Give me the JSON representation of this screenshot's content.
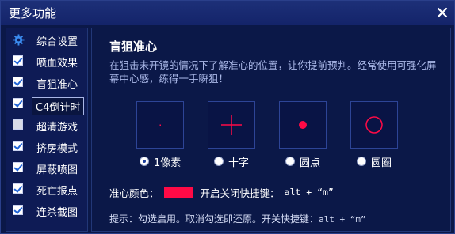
{
  "window": {
    "title": "更多功能"
  },
  "sidebar": {
    "items": [
      {
        "label": "综合设置",
        "icon": "gear-icon",
        "checked": null
      },
      {
        "label": "喷血效果",
        "checked": true
      },
      {
        "label": "盲狙准心",
        "checked": true
      },
      {
        "label": "C4倒计时",
        "checked": true,
        "selected": true
      },
      {
        "label": "超清游戏",
        "checked": false
      },
      {
        "label": "挤房模式",
        "checked": true
      },
      {
        "label": "屏蔽喷图",
        "checked": true
      },
      {
        "label": "死亡报点",
        "checked": true
      },
      {
        "label": "连杀截图",
        "checked": true
      }
    ]
  },
  "main": {
    "title": "盲狙准心",
    "description": "在狙击未开镜的情况下了解准心的位置，让你提前预判。经常使用可强化屏幕中心感，练得一手瞬狙！",
    "crosshair_options": [
      {
        "label": "1像素",
        "selected": true,
        "style": "dot-1px"
      },
      {
        "label": "十字",
        "selected": false,
        "style": "cross"
      },
      {
        "label": "圆点",
        "selected": false,
        "style": "filled-dot"
      },
      {
        "label": "圆圈",
        "selected": false,
        "style": "circle"
      }
    ],
    "color_label": "准心颜色：",
    "crosshair_color": "#ff0a46",
    "hotkey_label": "开启关闭快捷键：",
    "hotkey_value": "alt + “m”",
    "tip_text": "提示：勾选启用。取消勾选即还原。开关快捷键：",
    "tip_hotkey": "alt + “m”"
  }
}
